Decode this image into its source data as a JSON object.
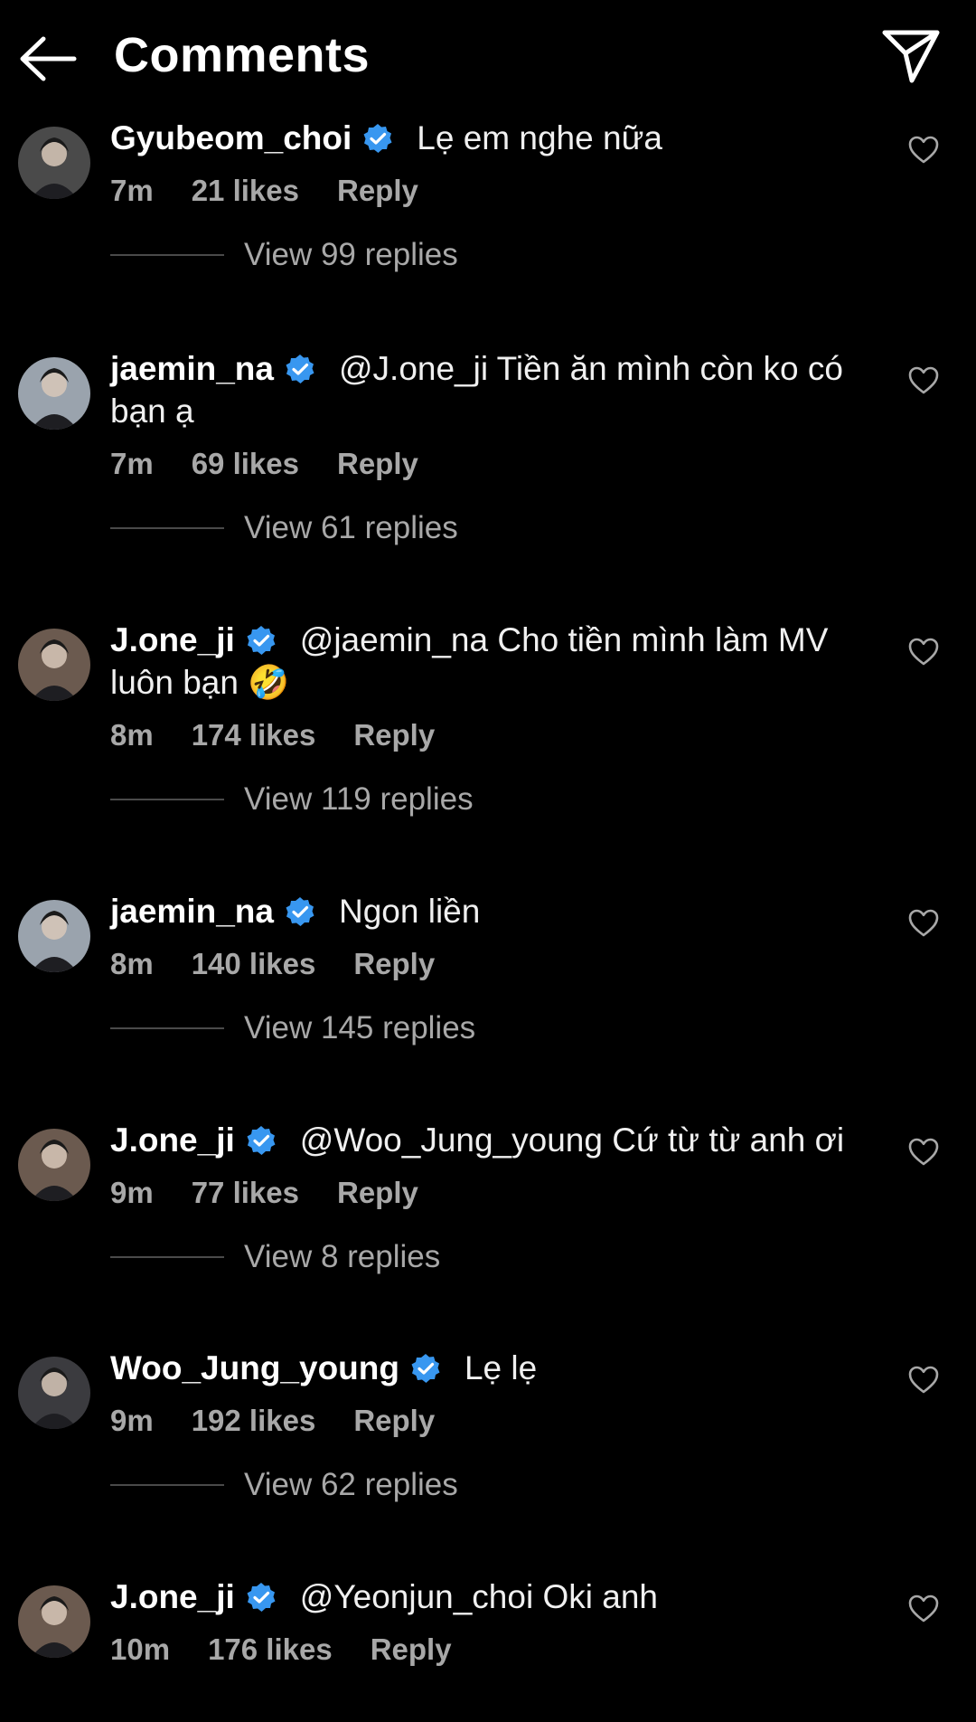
{
  "header": {
    "title": "Comments",
    "back_icon": "arrow-left-icon",
    "send_icon": "paper-plane-icon"
  },
  "colors": {
    "background": "#000000",
    "text": "#ffffff",
    "muted": "#a8a8a8",
    "verified": "#3897f0"
  },
  "comments": [
    {
      "username": "Gyubeom_choi",
      "text": "Lẹ em nghe nữa",
      "time": "7m",
      "likes": "21 likes",
      "reply": "Reply",
      "view_replies": "View 99 replies",
      "avatar_color": "#4a4a4a"
    },
    {
      "username": "jaemin_na",
      "text": "@J.one_ji Tiền ăn mình còn ko có bạn ạ",
      "time": "7m",
      "likes": "69 likes",
      "reply": "Reply",
      "view_replies": "View 61 replies",
      "avatar_color": "#9aa3ad"
    },
    {
      "username": "J.one_ji",
      "text": "@jaemin_na Cho tiền mình làm MV luôn bạn 🤣",
      "time": "8m",
      "likes": "174 likes",
      "reply": "Reply",
      "view_replies": "View 119 replies",
      "avatar_color": "#6b5a4f"
    },
    {
      "username": "jaemin_na",
      "text": "Ngon liền",
      "time": "8m",
      "likes": "140 likes",
      "reply": "Reply",
      "view_replies": "View 145 replies",
      "avatar_color": "#9aa3ad"
    },
    {
      "username": "J.one_ji",
      "text": "@Woo_Jung_young Cứ từ từ anh ơi",
      "time": "9m",
      "likes": "77 likes",
      "reply": "Reply",
      "view_replies": "View 8 replies",
      "avatar_color": "#6b5a4f"
    },
    {
      "username": "Woo_Jung_young",
      "text": "Lẹ lẹ",
      "time": "9m",
      "likes": "192 likes",
      "reply": "Reply",
      "view_replies": "View 62 replies",
      "avatar_color": "#3b3b3f"
    },
    {
      "username": "J.one_ji",
      "text": "@Yeonjun_choi Oki anh",
      "time": "10m",
      "likes": "176 likes",
      "reply": "Reply",
      "view_replies": "",
      "avatar_color": "#6b5a4f"
    }
  ]
}
